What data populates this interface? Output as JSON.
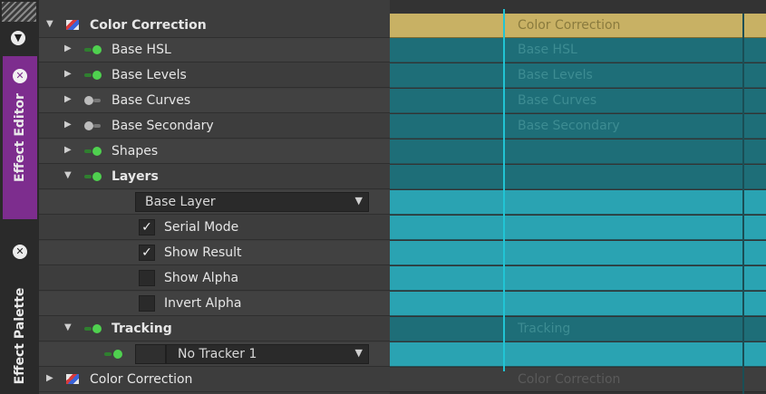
{
  "side_tabs": {
    "effect_editor": "Effect Editor",
    "effect_palette": "Effect Palette"
  },
  "tree": {
    "root": "Color Correction",
    "items": [
      "Base HSL",
      "Base Levels",
      "Base Curves",
      "Base Secondary",
      "Shapes"
    ],
    "layers": {
      "label": "Layers",
      "dropdown": "Base Layer",
      "checkboxes": [
        {
          "label": "Serial Mode",
          "checked": true
        },
        {
          "label": "Show Result",
          "checked": true
        },
        {
          "label": "Show Alpha",
          "checked": false
        },
        {
          "label": "Invert Alpha",
          "checked": false
        }
      ]
    },
    "tracking": {
      "label": "Tracking",
      "dropdown": "No Tracker 1"
    },
    "second_effect": "Color Correction"
  },
  "timeline": {
    "labels": [
      "Color Correction",
      "Base HSL",
      "Base Levels",
      "Base Curves",
      "Base Secondary",
      "Tracking",
      "Color Correction"
    ]
  },
  "colors": {
    "gold_track": "#c8b164",
    "teal_dark": "#1e6e78",
    "teal_light": "#2aa3b2",
    "effect_editor_tab": "#7d2d8e"
  },
  "icons": {
    "collapse": "caret-down-icon",
    "expand": "caret-right-icon",
    "enabled": "green-dot-icon",
    "disabled": "gray-dot-icon",
    "effect": "color-correction-icon",
    "close": "close-icon",
    "check": "checkmark-icon"
  }
}
